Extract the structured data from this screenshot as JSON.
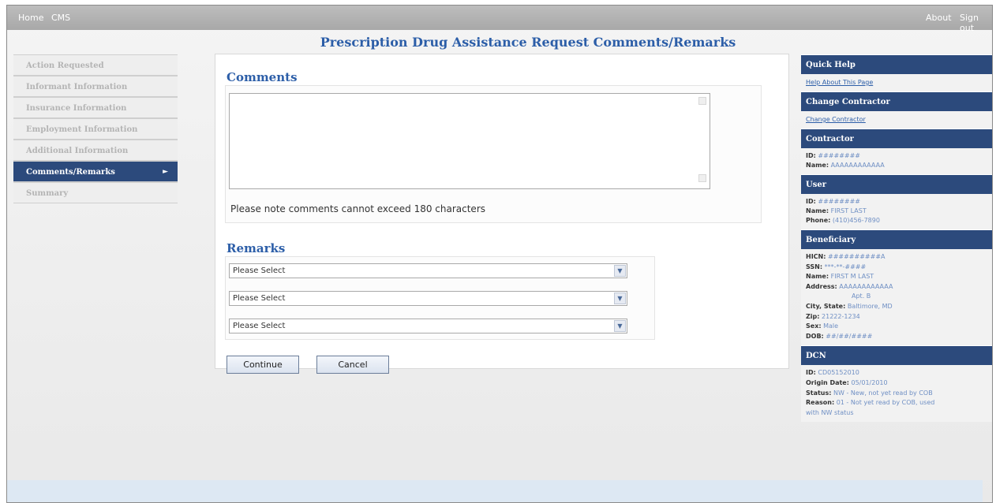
{
  "topbar": {
    "home": "Home",
    "cms": "CMS",
    "about": "About",
    "signout": "Sign out"
  },
  "page": {
    "title": "Prescription Drug Assistance Request Comments/Remarks"
  },
  "nav": {
    "items": [
      {
        "label": "Action Requested"
      },
      {
        "label": "Informant Information"
      },
      {
        "label": "Insurance Information"
      },
      {
        "label": "Employment Information"
      },
      {
        "label": "Additional Information"
      },
      {
        "label": "Comments/Remarks",
        "active": true
      },
      {
        "label": "Summary"
      }
    ],
    "arrow": "►"
  },
  "comments": {
    "heading": "Comments",
    "value": "",
    "note": "Please note comments cannot exceed 180 characters"
  },
  "remarks": {
    "heading": "Remarks",
    "selects": [
      "Please Select",
      "Please Select",
      "Please Select"
    ]
  },
  "buttons": {
    "continue": "Continue",
    "cancel": "Cancel"
  },
  "right": {
    "quick_help": {
      "title": "Quick Help",
      "link": "Help About This Page"
    },
    "change_contractor": {
      "title": "Change Contractor",
      "link": "Change Contractor"
    },
    "contractor": {
      "title": "Contractor",
      "id_label": "ID:",
      "id": "########",
      "name_label": "Name:",
      "name": "AAAAAAAAAAAA"
    },
    "user": {
      "title": "User",
      "id_label": "ID:",
      "id": "########",
      "name_label": "Name:",
      "name": "FIRST LAST",
      "phone_label": "Phone:",
      "phone": "(410)456-7890"
    },
    "beneficiary": {
      "title": "Beneficiary",
      "hicn_label": "HICN:",
      "hicn": "##########A",
      "ssn_label": "SSN:",
      "ssn": "***-**-####",
      "name_label": "Name:",
      "name": "FIRST M LAST",
      "address_label": "Address:",
      "address1": "AAAAAAAAAAAA",
      "address2": "Apt. B",
      "city_label": "City, State:",
      "city": "Baltimore, MD",
      "zip_label": "Zip:",
      "zip": "21222-1234",
      "sex_label": "Sex:",
      "sex": "Male",
      "dob_label": "DOB:",
      "dob": "##/##/####"
    },
    "dcn": {
      "title": "DCN",
      "id_label": "ID:",
      "id": "CD05152010",
      "origin_label": "Origin Date:",
      "origin": "05/01/2010",
      "status_label": "Status:",
      "status": "NW - New, not yet read by COB",
      "reason_label": "Reason:",
      "reason1": "01 - Not yet read by COB, used",
      "reason2": "with NW status"
    }
  },
  "colors": {
    "accent": "#2c5ea8",
    "nav_active": "#2c4a7c"
  }
}
